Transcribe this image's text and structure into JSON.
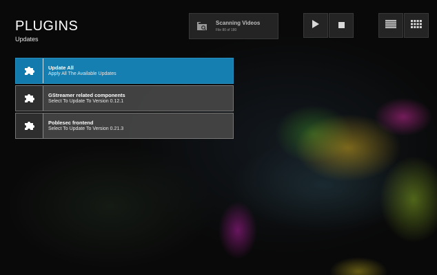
{
  "header": {
    "title": "PLUGINS",
    "subtitle": "Updates"
  },
  "status": {
    "icon": "scan-folder-icon",
    "title": "Scanning Videos",
    "subtitle": "File 80 of 180"
  },
  "controls": {
    "play_icon": "play-icon",
    "stop_icon": "stop-icon",
    "list_view_icon": "list-view-icon",
    "grid_view_icon": "grid-view-icon"
  },
  "updates": [
    {
      "title": "Update All",
      "subtitle": "Apply All The Available Updates",
      "icon": "puzzle-piece-icon",
      "selected": true
    },
    {
      "title": "GStreamer related components",
      "subtitle": "Select To Update To Version 0.12.1",
      "icon": "puzzle-piece-icon",
      "selected": false
    },
    {
      "title": "Poblesec frontend",
      "subtitle": "Select To Update To Version 0.21.3",
      "icon": "puzzle-piece-icon",
      "selected": false
    }
  ],
  "colors": {
    "accent": "#157fb2",
    "item_bg": "#484848"
  }
}
